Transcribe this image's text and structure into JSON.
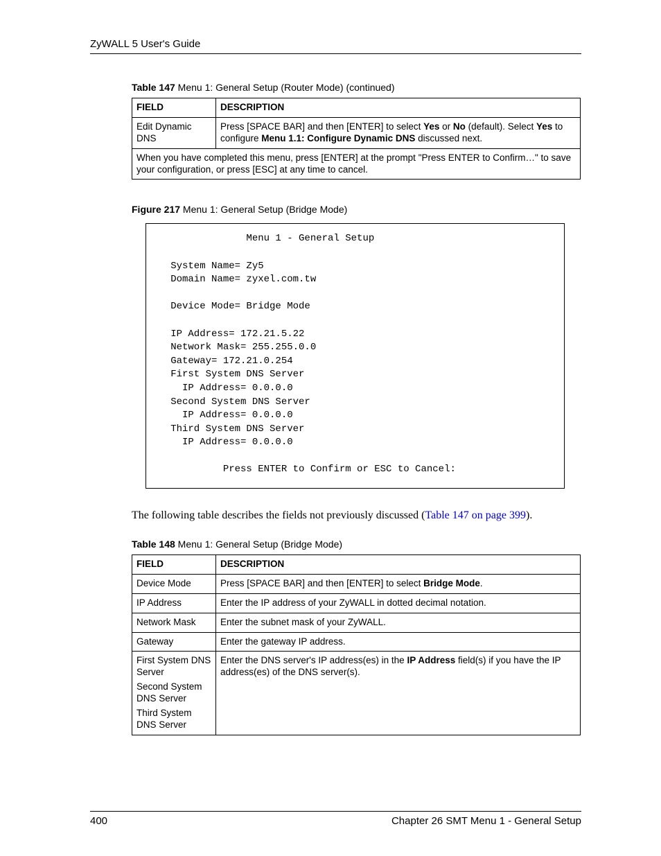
{
  "header": "ZyWALL 5 User's Guide",
  "table147": {
    "caption_bold": "Table 147",
    "caption_rest": "   Menu 1: General Setup (Router Mode) (continued)",
    "col_field": "FIELD",
    "col_desc": "DESCRIPTION",
    "row_field": "Edit Dynamic DNS",
    "row_desc_a": "Press [SPACE BAR] and then [ENTER] to select ",
    "row_desc_b": "Yes",
    "row_desc_c": " or ",
    "row_desc_d": "No",
    "row_desc_e": " (default). Select ",
    "row_desc_f": "Yes",
    "row_desc_g": " to configure ",
    "row_desc_h": "Menu 1.1: Configure Dynamic DNS",
    "row_desc_i": " discussed next.",
    "footer_row": "When you have completed this menu, press [ENTER] at the prompt \"Press ENTER to Confirm…\" to save your configuration, or press [ESC] at any time to cancel."
  },
  "figure": {
    "caption_bold": "Figure 217",
    "caption_rest": "   Menu 1: General Setup (Bridge Mode)",
    "content": "                Menu 1 - General Setup\n\n   System Name= Zy5\n   Domain Name= zyxel.com.tw\n\n   Device Mode= Bridge Mode\n\n   IP Address= 172.21.5.22\n   Network Mask= 255.255.0.0\n   Gateway= 172.21.0.254\n   First System DNS Server\n     IP Address= 0.0.0.0\n   Second System DNS Server\n     IP Address= 0.0.0.0\n   Third System DNS Server\n     IP Address= 0.0.0.0\n\n            Press ENTER to Confirm or ESC to Cancel:"
  },
  "paragraph": {
    "text_a": "The following table describes the fields not previously discussed (",
    "xref": "Table 147 on page 399",
    "text_b": ")."
  },
  "table148": {
    "caption_bold": "Table 148",
    "caption_rest": "   Menu 1: General Setup (Bridge Mode)",
    "col_field": "FIELD",
    "col_desc": "DESCRIPTION",
    "rows": {
      "r1f": "Device Mode",
      "r1d_a": "Press [SPACE BAR] and then [ENTER] to select ",
      "r1d_b": "Bridge Mode",
      "r1d_c": ".",
      "r2f": "IP Address",
      "r2d": "Enter the IP address of your ZyWALL in dotted decimal notation.",
      "r3f": "Network Mask",
      "r3d": "Enter the subnet mask of your ZyWALL.",
      "r4f": "Gateway",
      "r4d": "Enter the gateway IP address.",
      "r5f1": "First System DNS Server",
      "r5f2": "Second System DNS Server",
      "r5f3": "Third System DNS Server",
      "r5d_a": "Enter the DNS server's IP address(es) in the ",
      "r5d_b": "IP Address",
      "r5d_c": " field(s) if  you have the IP address(es) of the DNS server(s)."
    }
  },
  "footer": {
    "page": "400",
    "chapter": "Chapter 26 SMT Menu 1 - General Setup"
  }
}
